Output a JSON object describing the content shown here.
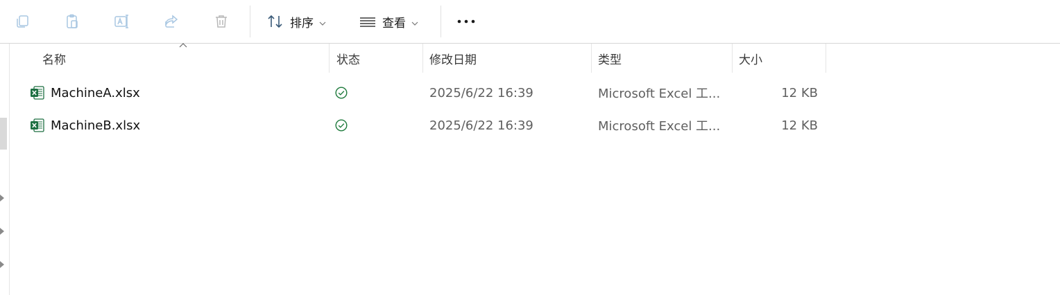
{
  "toolbar": {
    "sort_label": "排序",
    "view_label": "查看",
    "icons": [
      "copy-icon",
      "paste-icon",
      "rename-icon",
      "share-icon",
      "delete-icon",
      "sort-icon",
      "view-icon",
      "more-icon"
    ]
  },
  "columns": {
    "name": "名称",
    "status": "状态",
    "modified": "修改日期",
    "type": "类型",
    "size": "大小"
  },
  "files": [
    {
      "name": "MachineA.xlsx",
      "status": "synced",
      "modified": "2025/6/22 16:39",
      "type": "Microsoft Excel 工...",
      "size": "12 KB"
    },
    {
      "name": "MachineB.xlsx",
      "status": "synced",
      "modified": "2025/6/22 16:39",
      "type": "Microsoft Excel 工...",
      "size": "12 KB"
    }
  ],
  "colors": {
    "accent_icon": "#9fc3e0",
    "disabled_icon": "#b8b8b8",
    "sync_green": "#1e7a3c",
    "excel_green": "#1d6f42"
  }
}
